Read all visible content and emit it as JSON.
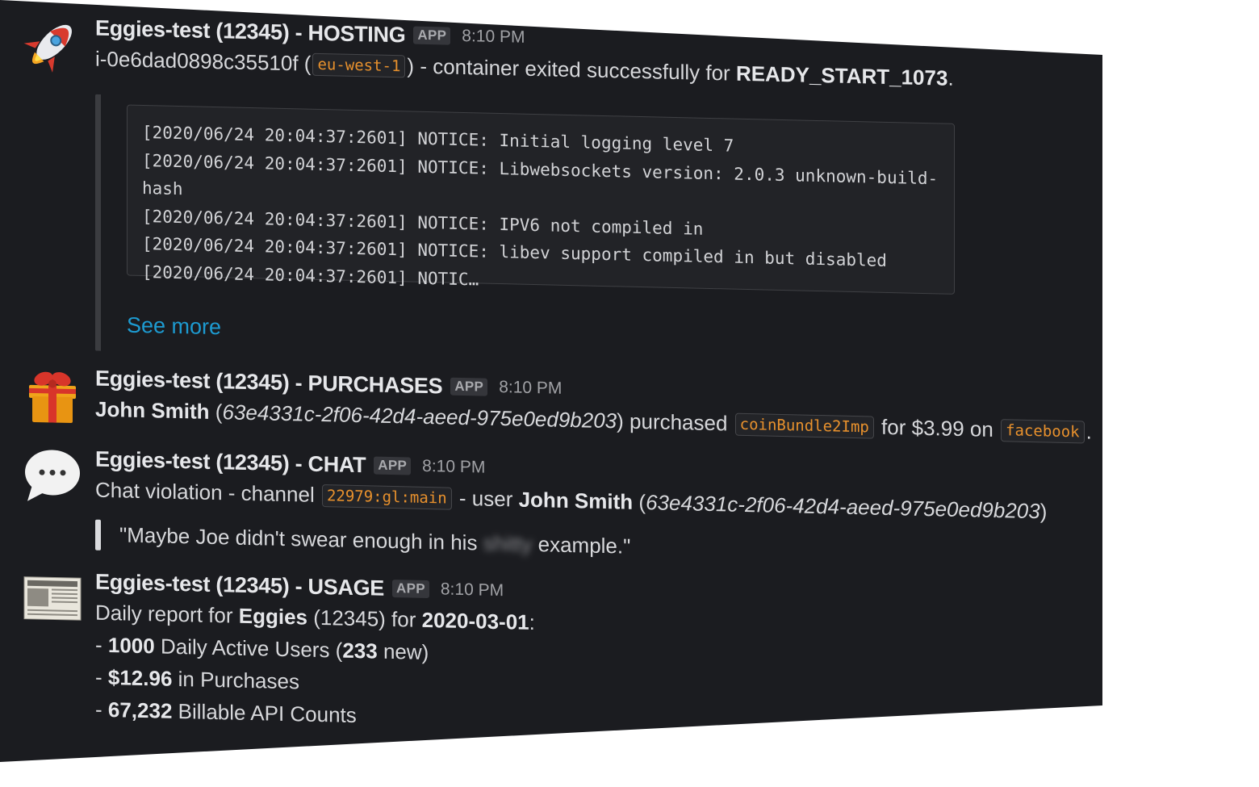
{
  "messages": {
    "hosting": {
      "sender": "Eggies-test (12345) - HOSTING",
      "badge": "APP",
      "time": "8:10 PM",
      "instance": "i-0e6dad0898c35510f",
      "region": "eu-west-1",
      "text_mid": " - container exited successfully for ",
      "build": "READY_START_1073",
      "end": ".",
      "log_lines": [
        "[2020/06/24 20:04:37:2601] NOTICE: Initial logging level 7",
        "[2020/06/24 20:04:37:2601] NOTICE: Libwebsockets version: 2.0.3 unknown-build-",
        "hash",
        "[2020/06/24 20:04:37:2601] NOTICE: IPV6 not compiled in",
        "[2020/06/24 20:04:37:2601] NOTICE: libev support compiled in but disabled",
        "[2020/06/24 20:04:37:2601] NOTIC…"
      ],
      "see_more": "See more"
    },
    "purchases": {
      "sender": "Eggies-test (12345) - PURCHASES",
      "badge": "APP",
      "time": "8:10 PM",
      "user": "John Smith",
      "user_id": "63e4331c-2f06-42d4-aeed-975e0ed9b203",
      "verb": " purchased ",
      "item": "coinBundle2Imp",
      "price_text": " for $3.99 on ",
      "platform": "facebook",
      "end": "."
    },
    "chat": {
      "sender": "Eggies-test (12345) - CHAT",
      "badge": "APP",
      "time": "8:10 PM",
      "prefix": "Chat violation - channel ",
      "channel": "22979:gl:main",
      "mid": " - user ",
      "user": "John Smith",
      "user_id": "63e4331c-2f06-42d4-aeed-975e0ed9b203",
      "quote_start": "\"Maybe Joe didn't swear enough in his ",
      "quote_censored": "shitty",
      "quote_end": "example.\""
    },
    "usage": {
      "sender": "Eggies-test (12345) - USAGE",
      "badge": "APP",
      "time": "8:10 PM",
      "intro": "Daily report for ",
      "app": "Eggies",
      "app_id": " (12345) for ",
      "date": "2020-03-01",
      "colon": ":",
      "dau": "1000",
      "dau_label": " Daily Active Users (",
      "new_users": "233",
      "new_label": " new)",
      "purchases": "$12.96",
      "purchases_label": " in Purchases",
      "api": "67,232",
      "api_label": " Billable API Counts",
      "dash": "- "
    }
  },
  "colors": {
    "background": "#1b1c20",
    "code_orange": "#e8912d",
    "link_blue": "#1d9bd1"
  },
  "icons": [
    "rocket-icon",
    "gift-icon",
    "speech-bubble-icon",
    "newspaper-icon"
  ]
}
